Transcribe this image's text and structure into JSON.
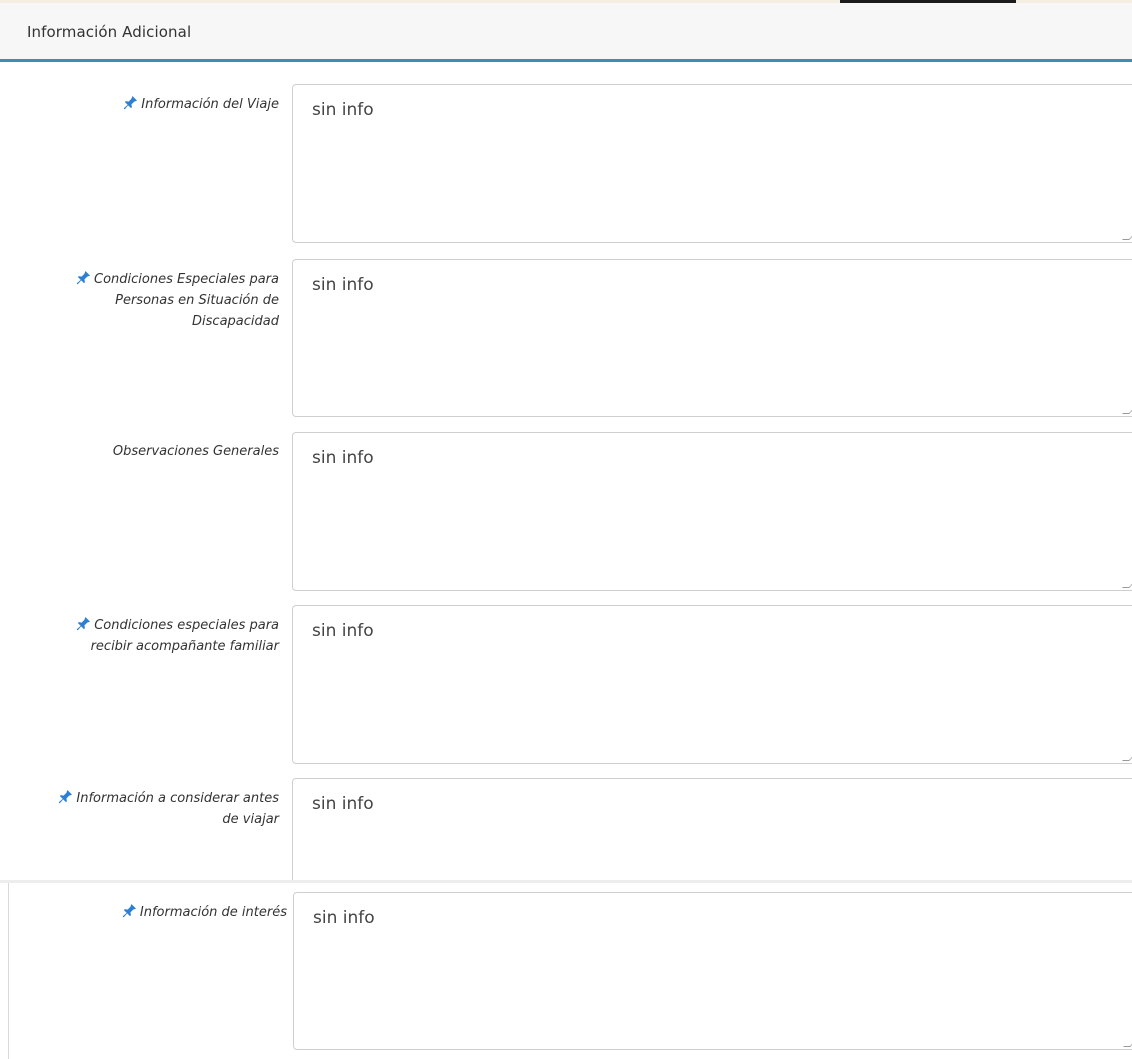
{
  "panel": {
    "title": "Información Adicional"
  },
  "fields": [
    {
      "label": "Información del Viaje",
      "value": "sin info",
      "pinned": true
    },
    {
      "label": "Condiciones Especiales para Personas en Situación de Discapacidad",
      "value": "sin info",
      "pinned": true
    },
    {
      "label": "Observaciones Generales",
      "value": "sin info",
      "pinned": false
    },
    {
      "label": "Condiciones especiales para recibir acompañante familiar",
      "value": "sin info",
      "pinned": true
    },
    {
      "label": "Información a considerar antes de viajar",
      "value": "sin info",
      "pinned": true
    },
    {
      "label": "Información de interés",
      "value": "sin info",
      "pinned": true
    }
  ],
  "icons": {
    "pin": "pushpin-icon"
  },
  "colors": {
    "accent": "#3c8dbc",
    "pin": "#2d7fd3",
    "heading_bg": "#f7f7f7",
    "border": "#cfcfcf"
  }
}
